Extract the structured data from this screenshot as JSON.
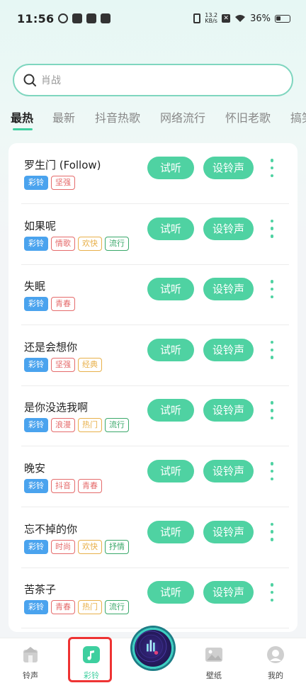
{
  "status_bar": {
    "time": "11:56",
    "net_speed_value": "13.2",
    "net_speed_unit": "KB/s",
    "battery": "36%"
  },
  "search": {
    "placeholder": "肖战"
  },
  "tabs": [
    "最热",
    "最新",
    "抖音热歌",
    "网络流行",
    "怀旧老歌",
    "搞笑"
  ],
  "buttons": {
    "listen": "试听",
    "set_ringtone": "设铃声"
  },
  "songs": [
    {
      "title": "罗生门 (Follow)",
      "tags": [
        "彩铃",
        "坚强"
      ]
    },
    {
      "title": "如果呢",
      "tags": [
        "彩铃",
        "情歌",
        "欢快",
        "流行"
      ]
    },
    {
      "title": "失眠",
      "tags": [
        "彩铃",
        "青春"
      ]
    },
    {
      "title": "还是会想你",
      "tags": [
        "彩铃",
        "坚强",
        "经典"
      ]
    },
    {
      "title": "是你没选我啊",
      "tags": [
        "彩铃",
        "浪漫",
        "热门",
        "流行"
      ]
    },
    {
      "title": "晚安",
      "tags": [
        "彩铃",
        "抖音",
        "青春"
      ]
    },
    {
      "title": "忘不掉的你",
      "tags": [
        "彩铃",
        "时尚",
        "欢快",
        "抒情"
      ]
    },
    {
      "title": "苦茶子",
      "tags": [
        "彩铃",
        "青春",
        "热门",
        "流行"
      ]
    }
  ],
  "tag_colors": {
    "彩铃": "#4aa3ee",
    "坚强": "#e56b6b",
    "情歌": "#e56b6b",
    "欢快": "#e8b04a",
    "流行": "#3aa86a",
    "青春": "#e56b6b",
    "经典": "#e8b04a",
    "浪漫": "#e56b6b",
    "热门": "#e8b04a",
    "抖音": "#e56b6b",
    "时尚": "#e56b6b",
    "抒情": "#3aa86a"
  },
  "bottom_nav": [
    {
      "label": "铃声",
      "icon": "house-icon"
    },
    {
      "label": "彩铃",
      "icon": "music-note-icon",
      "active": true
    },
    {
      "label": "",
      "icon": "music-disc-icon"
    },
    {
      "label": "壁纸",
      "icon": "picture-icon"
    },
    {
      "label": "我的",
      "icon": "profile-icon"
    }
  ],
  "colors": {
    "accent": "#4fd2a2",
    "active_tab_underline": "#3ecf9f",
    "search_border": "#7fd6bf",
    "highlight": "#e33333"
  }
}
